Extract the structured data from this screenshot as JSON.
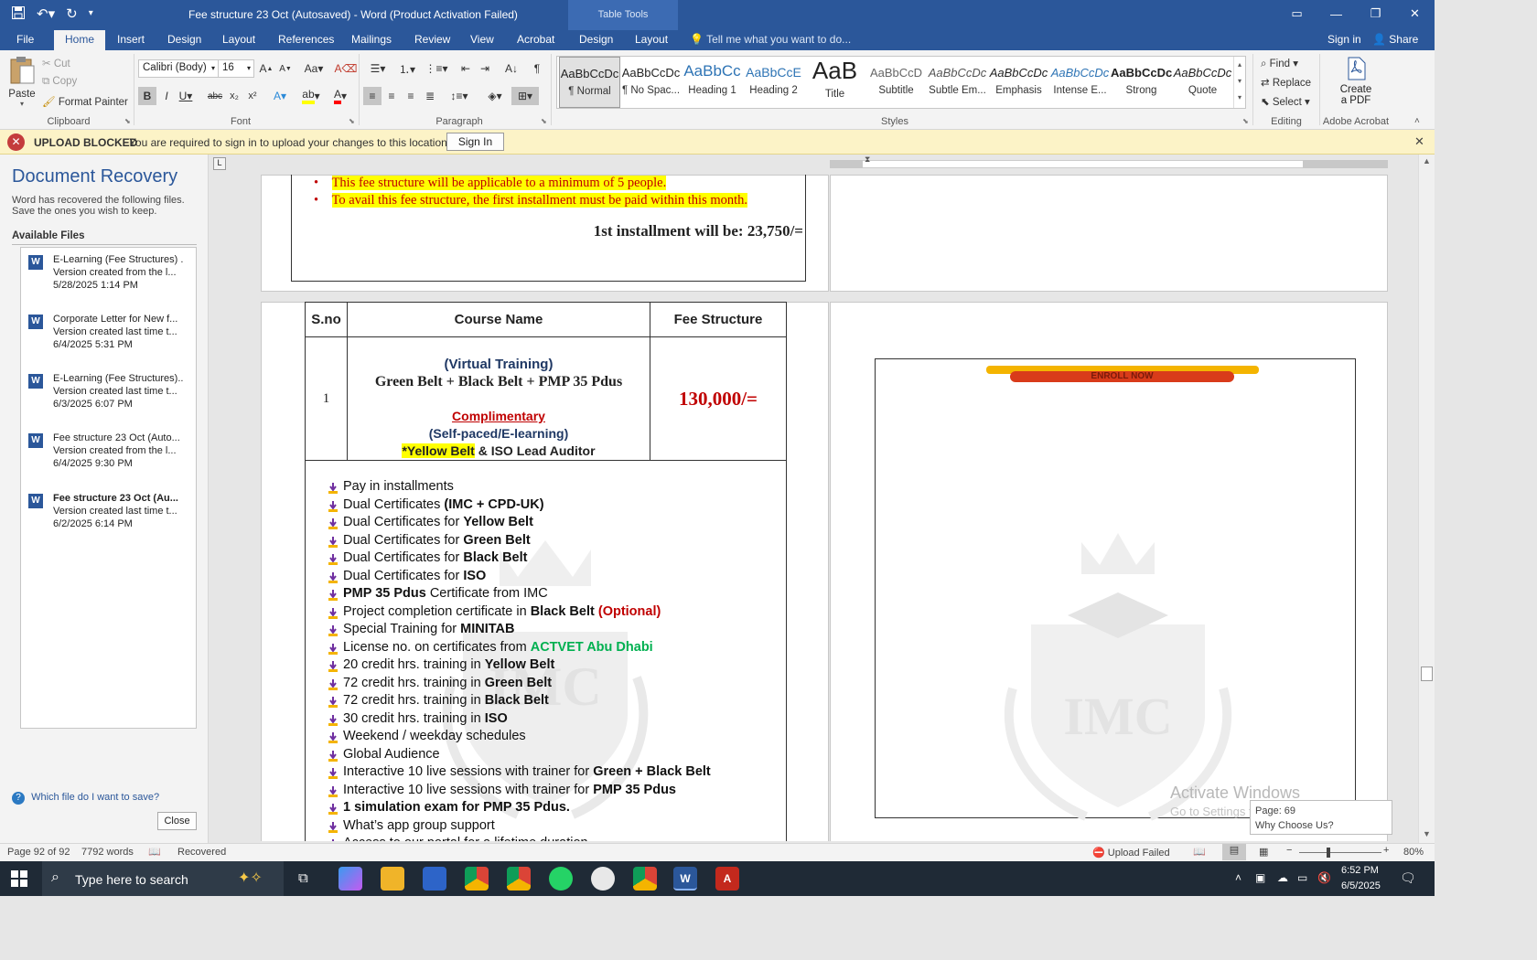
{
  "titlebar": {
    "title": "Fee structure 23 Oct (Autosaved) - Word (Product Activation Failed)",
    "context_tab": "Table Tools",
    "tell_me": "Tell me what you want to do...",
    "sign_in": "Sign in",
    "share": "Share"
  },
  "tabs": [
    "File",
    "Home",
    "Insert",
    "Design",
    "Layout",
    "References",
    "Mailings",
    "Review",
    "View",
    "Acrobat",
    "Design",
    "Layout"
  ],
  "ribbon": {
    "clipboard": {
      "paste": "Paste",
      "cut": "Cut",
      "copy": "Copy",
      "format_painter": "Format Painter",
      "label": "Clipboard"
    },
    "font": {
      "family": "Calibri (Body)",
      "size": "16",
      "label": "Font"
    },
    "paragraph": {
      "label": "Paragraph"
    },
    "styles": {
      "label": "Styles",
      "items": [
        {
          "preview": "AaBbCcDc",
          "name": "¶ Normal"
        },
        {
          "preview": "AaBbCcDc",
          "name": "¶ No Spac..."
        },
        {
          "preview": "AaBbCc",
          "name": "Heading 1"
        },
        {
          "preview": "AaBbCcE",
          "name": "Heading 2"
        },
        {
          "preview": "AaB",
          "name": "Title"
        },
        {
          "preview": "AaBbCcD",
          "name": "Subtitle"
        },
        {
          "preview": "AaBbCcDc",
          "name": "Subtle Em..."
        },
        {
          "preview": "AaBbCcDc",
          "name": "Emphasis"
        },
        {
          "preview": "AaBbCcDc",
          "name": "Intense E..."
        },
        {
          "preview": "AaBbCcDc",
          "name": "Strong"
        },
        {
          "preview": "AaBbCcDc",
          "name": "Quote"
        }
      ]
    },
    "editing": {
      "find": "Find",
      "replace": "Replace",
      "select": "Select",
      "label": "Editing"
    },
    "acrobat": {
      "create": "Create",
      "pdf": "a PDF",
      "label": "Adobe Acrobat"
    }
  },
  "message_bar": {
    "title": "UPLOAD BLOCKED",
    "text": "You are required to sign in to upload your changes to this location.",
    "button": "Sign In"
  },
  "recovery": {
    "title": "Document Recovery",
    "desc1": "Word has recovered the following files.",
    "desc2": "Save the ones you wish to keep.",
    "available": "Available Files",
    "files": [
      {
        "name": "E-Learning (Fee Structures) ..",
        "desc": "Version created from the l...",
        "date": "5/28/2025 1:14 PM"
      },
      {
        "name": "Corporate Letter for New f...",
        "desc": "Version created last time t...",
        "date": "6/4/2025 5:31 PM"
      },
      {
        "name": "E-Learning (Fee Structures)...",
        "desc": "Version created last time t...",
        "date": "6/3/2025 6:07 PM"
      },
      {
        "name": "Fee structure 23 Oct (Auto...",
        "desc": "Version created from the l...",
        "date": "6/4/2025 9:30 PM"
      },
      {
        "name": "Fee structure 23 Oct (Au...",
        "desc": "Version created last time t...",
        "date": "6/2/2025 6:14 PM"
      }
    ],
    "help": "Which file do I want to save?",
    "close": "Close"
  },
  "doc": {
    "bullet1": "This fee structure will be applicable to a minimum of 5 people.",
    "bullet2": "To avail this fee structure, the first installment must be paid within this month.",
    "installment": "1st installment will be: 23,750/=",
    "table": {
      "h1": "S.no",
      "h2": "Course Name",
      "h3": "Fee Structure",
      "sno": "1",
      "virtual": "(Virtual Training)",
      "course": "Green Belt + Black Belt + PMP 35 Pdus",
      "complimentary": "Complimentary",
      "selfpaced": "(Self-paced/E-learning)",
      "yellow_hl": "*Yellow Belt",
      "yellow_rest": " & ISO Lead Auditor",
      "fee": "130,000/="
    },
    "features": [
      [
        "Pay in installments",
        ""
      ],
      [
        "Dual Certificates ",
        "(IMC + CPD-UK)"
      ],
      [
        "Dual Certificates for ",
        "Yellow Belt"
      ],
      [
        "Dual Certificates for ",
        "Green Belt"
      ],
      [
        "Dual Certificates for ",
        "Black Belt"
      ],
      [
        " Dual Certificates for ",
        "ISO"
      ],
      [
        "",
        "PMP 35 Pdus",
        "Certificate from IMC"
      ],
      [
        "Project completion certificate in ",
        "Black Belt",
        "(Optional)"
      ],
      [
        "Special Training for ",
        "MINITAB"
      ],
      [
        "License no. on certificates from ",
        "ACTVET Abu Dhabi"
      ],
      [
        "20 credit hrs. training in ",
        "Yellow Belt"
      ],
      [
        "72 credit hrs. training in ",
        "Green Belt"
      ],
      [
        "72 credit hrs. training in ",
        "Black Belt"
      ],
      [
        "30 credit hrs. training in ",
        "ISO"
      ],
      [
        "Weekend / weekday schedules",
        ""
      ],
      [
        "Global Audience",
        ""
      ],
      [
        "Interactive 10 live sessions with trainer for ",
        "Green + Black Belt"
      ],
      [
        "Interactive 10 live sessions with trainer for ",
        "PMP 35 Pdus"
      ],
      [
        "",
        "1 simulation exam for PMP 35 Pdus."
      ],
      [
        "What’s app group support",
        ""
      ],
      [
        "Access to our portal for a lifetime duration",
        ""
      ]
    ],
    "enroll": "ENROLL NOW",
    "watermark": "IMC",
    "activate1": "Activate Windows",
    "activate2": "Go to Settings to activate Windows.",
    "tooltip1": "Page: 69",
    "tooltip2": "Why Choose Us?"
  },
  "status": {
    "page": "Page 92 of 92",
    "words": "7792 words",
    "recovered": "Recovered",
    "upload": "Upload Failed",
    "zoom": "80%"
  },
  "taskbar": {
    "search": "Type here to search",
    "time": "6:52 PM",
    "date": "6/5/2025"
  },
  "colors": {
    "accent": "#2b579a",
    "highlight": "#ffff00",
    "fee_red": "#c00000",
    "navy": "#1f3864",
    "green": "#00b050"
  }
}
